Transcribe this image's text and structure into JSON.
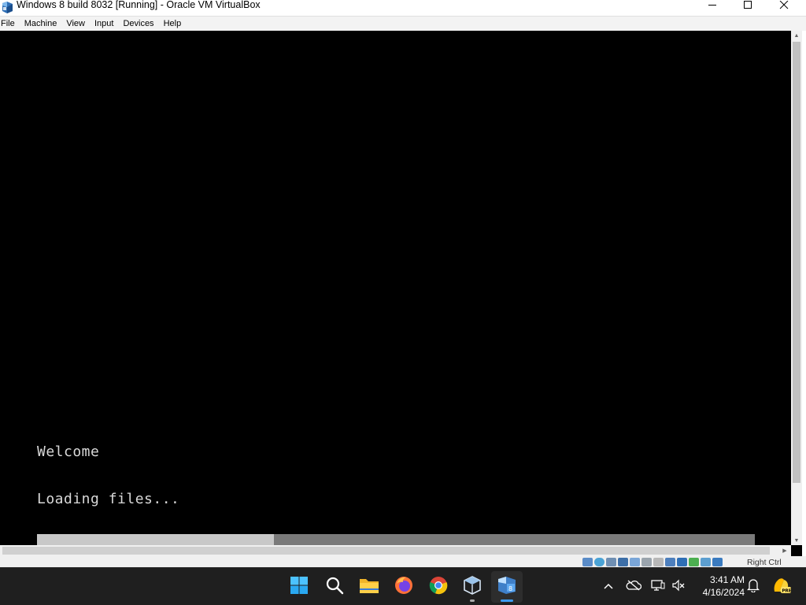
{
  "window": {
    "title": "Windows 8 build 8032 [Running] - Oracle VM VirtualBox",
    "icons": {
      "app": "virtualbox-icon",
      "minimize": "minimize-icon",
      "maximize": "maximize-icon",
      "close": "close-icon"
    }
  },
  "menubar": {
    "items": [
      {
        "label": "File"
      },
      {
        "label": "Machine"
      },
      {
        "label": "View"
      },
      {
        "label": "Input"
      },
      {
        "label": "Devices"
      },
      {
        "label": "Help"
      }
    ]
  },
  "vm": {
    "welcome": "Welcome",
    "loading": "Loading files...",
    "progress_fraction": 0.33
  },
  "statusbar": {
    "host_key": "Right Ctrl",
    "indicators": [
      "hard-disk-icon",
      "optical-drive-icon",
      "audio-icon",
      "network-icon",
      "usb-icon",
      "shared-folders-icon",
      "display-icon",
      "video-capture-icon",
      "recording-icon",
      "cpu-icon",
      "mouse-integration-icon",
      "keyboard-icon"
    ]
  },
  "taskbar": {
    "apps": [
      "start-icon",
      "search-icon",
      "file-explorer-icon",
      "firefox-icon",
      "chrome-icon",
      "virtualbox-manager-icon",
      "virtualbox-vm-icon"
    ],
    "tray": [
      "show-hidden-icons-chevron",
      "onedrive-icon",
      "display-network-icon",
      "volume-muted-icon"
    ],
    "time": "3:41 AM",
    "date": "4/16/2024",
    "accent": "#3b9bf0"
  }
}
